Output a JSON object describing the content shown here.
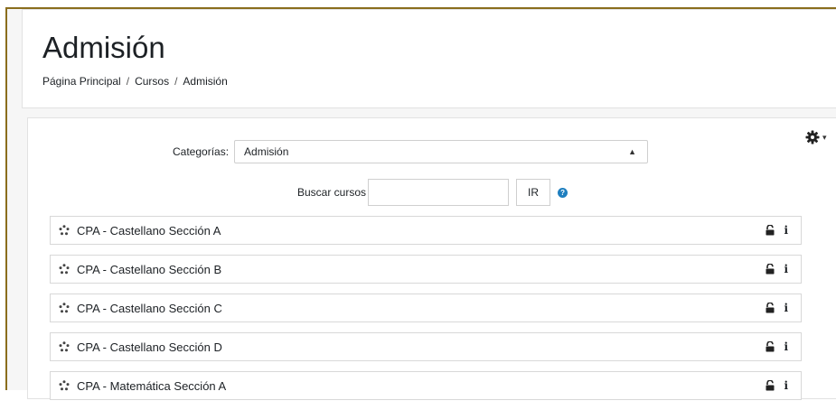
{
  "header": {
    "title": "Admisión",
    "breadcrumb": [
      "Página Principal",
      "Cursos",
      "Admisión"
    ],
    "separator": "/"
  },
  "filters": {
    "category_label": "Categorías:",
    "category_selected": "Admisión",
    "search_label": "Buscar cursos",
    "search_value": "",
    "go_button": "IR"
  },
  "courses": [
    {
      "name": "CPA - Castellano Sección A"
    },
    {
      "name": "CPA - Castellano Sección B"
    },
    {
      "name": "CPA - Castellano Sección C"
    },
    {
      "name": "CPA - Castellano Sección D"
    },
    {
      "name": "CPA - Matemática Sección A"
    }
  ],
  "icons": {
    "settings": "gear-icon",
    "help": "help-icon",
    "course": "course-node-icon",
    "access": "unlock-icon",
    "info": "info-icon"
  },
  "colors": {
    "frame_border": "#8a6d1d",
    "help_blue": "#1f7fbf"
  }
}
